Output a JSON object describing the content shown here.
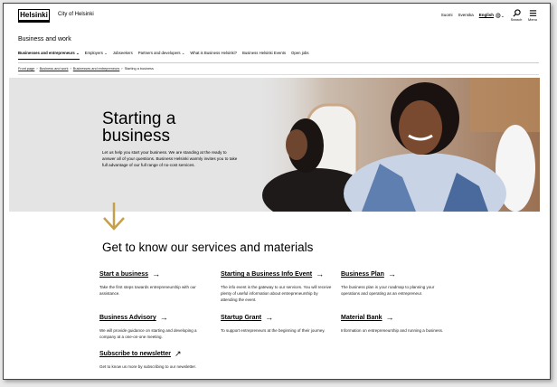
{
  "header": {
    "logo": "Helsinki",
    "city": "City of Helsinki",
    "languages": [
      "Suomi",
      "Svenska",
      "English"
    ],
    "active_language": "English",
    "search_label": "Search",
    "menu_label": "Menu"
  },
  "section": {
    "title": "Business and work",
    "nav": [
      {
        "label": "Businesses and entrepreneurs",
        "chevron": "⌄"
      },
      {
        "label": "Employers",
        "chevron": "⌄"
      },
      {
        "label": "Jobseekers",
        "chevron": ""
      },
      {
        "label": "Partners and developers",
        "chevron": "⌄"
      },
      {
        "label": "What is Business Helsinki?",
        "chevron": ""
      },
      {
        "label": "Business Helsinki Events",
        "chevron": ""
      },
      {
        "label": "Open jobs",
        "chevron": ""
      }
    ]
  },
  "breadcrumb": [
    "Front page",
    "Business and work",
    "Businesses and entrepreneurs",
    "Starting a business"
  ],
  "hero": {
    "title": "Starting a business",
    "text": "Let us help you start your business. We are standing at the ready to answer all of your questions. Business Helsinki warmly invites you to take full advantage of our full range of no-cost services."
  },
  "services": {
    "heading": "Get to know our services and materials",
    "items": [
      {
        "title": "Start a business",
        "arrow": "→",
        "text": "Take the first steps towards entrepreneurship with our assistance."
      },
      {
        "title": "Starting a Business Info Event",
        "arrow": "→",
        "text": "The info event is the gateway to our services. You will receive plenty of useful information about entrepreneurship by attending the event."
      },
      {
        "title": "Business Plan",
        "arrow": "→",
        "text": "The business plan is your roadmap to planning your operations and operating as an entrepreneur."
      },
      {
        "title": "Business Advisory",
        "arrow": "→",
        "text": "We will provide guidance on starting and developing a company at a one-on-one meeting."
      },
      {
        "title": "Startup Grant",
        "arrow": "→",
        "text": "To support entrepreneurs at the beginning of their journey."
      },
      {
        "title": "Material Bank",
        "arrow": "→",
        "text": "Information on entrepreneurship and running a business."
      },
      {
        "title": "Subscribe to newsletter",
        "arrow": "↗",
        "text": "Get to know us more by subscribing to our newsletter."
      }
    ]
  },
  "colors": {
    "accent_arrow": "#c5a04a"
  }
}
